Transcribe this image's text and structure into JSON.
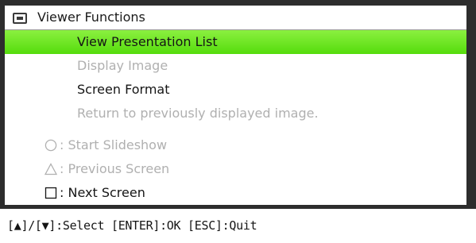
{
  "menu": {
    "title": "Viewer Functions",
    "title_icon": "viewer-icon",
    "items": [
      {
        "label": "View Presentation List",
        "state": "selected"
      },
      {
        "label": "Display Image",
        "state": "disabled"
      },
      {
        "label": "Screen Format",
        "state": "enabled"
      },
      {
        "label": "Return to previously displayed image.",
        "state": "disabled"
      }
    ],
    "keys": [
      {
        "symbol": "circle",
        "label": ": Start Slideshow",
        "state": "disabled"
      },
      {
        "symbol": "triangle",
        "label": ": Previous Screen",
        "state": "disabled"
      },
      {
        "symbol": "square",
        "label": ": Next Screen",
        "state": "enabled"
      }
    ]
  },
  "footer": {
    "help": "[▲]/[▼]:Select [ENTER]:OK [ESC]:Quit"
  },
  "colors": {
    "frame": "#2d2d2d",
    "highlight": "#6be423",
    "disabled_text": "#b0b0b0",
    "text": "#151515"
  }
}
